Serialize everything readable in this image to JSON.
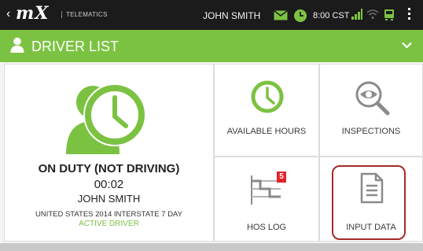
{
  "status_bar": {
    "app_name": "TELEMATICS",
    "user": "JOHN SMITH",
    "time": "8:00 CST"
  },
  "header": {
    "title": "DRIVER LIST"
  },
  "driver_panel": {
    "duty_status": "ON DUTY (NOT DRIVING)",
    "duty_time": "00:02",
    "driver_name": "JOHN SMITH",
    "ruleset": "UNITED STATES 2014 INTERSTATE 7 DAY",
    "role": "ACTIVE DRIVER"
  },
  "tiles": [
    {
      "label": "AVAILABLE HOURS",
      "icon": "clock-icon"
    },
    {
      "label": "INSPECTIONS",
      "icon": "eye-magnifier-icon"
    },
    {
      "label": "HOS LOG",
      "icon": "hos-log-icon",
      "badge": "5"
    },
    {
      "label": "INPUT DATA",
      "icon": "document-icon"
    }
  ],
  "colors": {
    "accent": "#7cc242",
    "badge": "#e0242b",
    "highlight": "#a52a2a",
    "status_bg": "#1b1b1b"
  }
}
